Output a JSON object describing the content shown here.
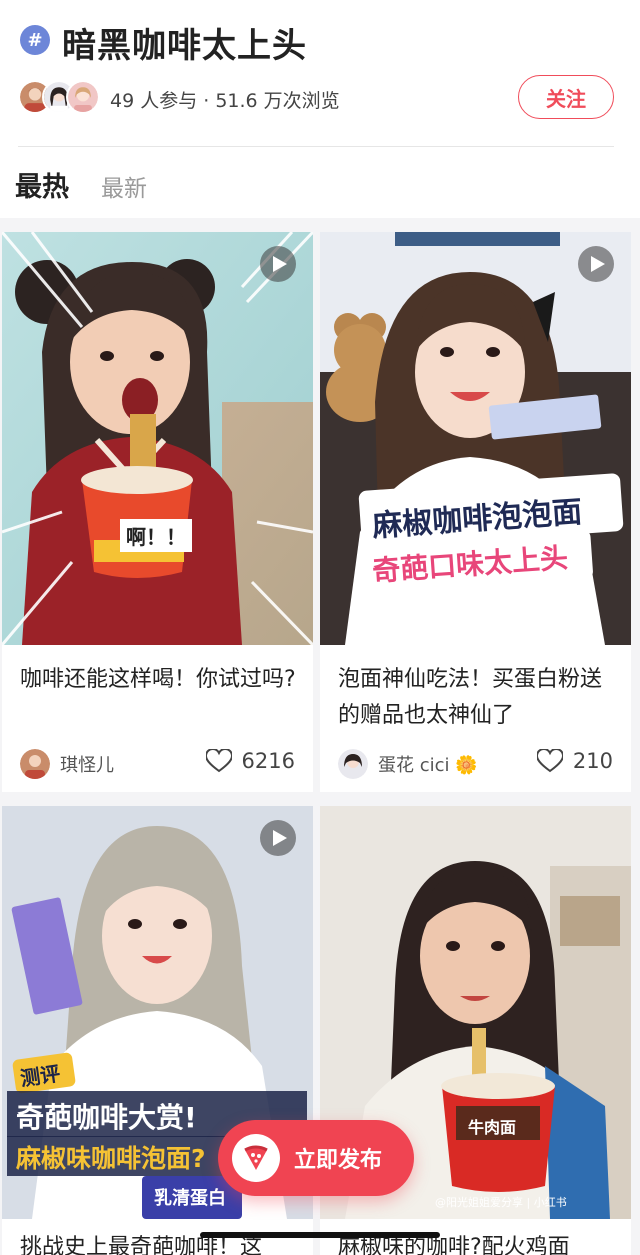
{
  "topic": {
    "hash_symbol": "#",
    "title": "暗黑咖啡太上头",
    "stats": "49 人参与 · 51.6 万次浏览",
    "follow_label": "关注"
  },
  "tabs": [
    {
      "label": "最热",
      "active": true
    },
    {
      "label": "最新",
      "active": false
    }
  ],
  "posts": [
    {
      "title": "咖啡还能这样喝！你试过吗?",
      "author": "琪怪儿",
      "likes": "6216",
      "image_text": [
        "啊！！"
      ]
    },
    {
      "title": "泡面神仙吃法！买蛋白粉送的赠品也太神仙了",
      "author": "蛋花 cici 🌼",
      "likes": "210",
      "image_text": [
        "麻椒咖啡泡泡面",
        "奇葩口味太上头"
      ]
    },
    {
      "title": "挑战史上最奇葩咖啡！这",
      "image_text": [
        "测评",
        "奇葩咖啡大赏!",
        "麻椒味咖啡泡面?",
        "乳清蛋白"
      ]
    },
    {
      "title": "麻椒味的咖啡?配火鸡面",
      "image_text": [
        "牛肉面",
        "@阳光姐姐爱分享 | 小红书"
      ]
    }
  ],
  "publish": {
    "label": "立即发布"
  },
  "colors": {
    "accent": "#f04452",
    "hash_badge": "#6d86d8"
  }
}
